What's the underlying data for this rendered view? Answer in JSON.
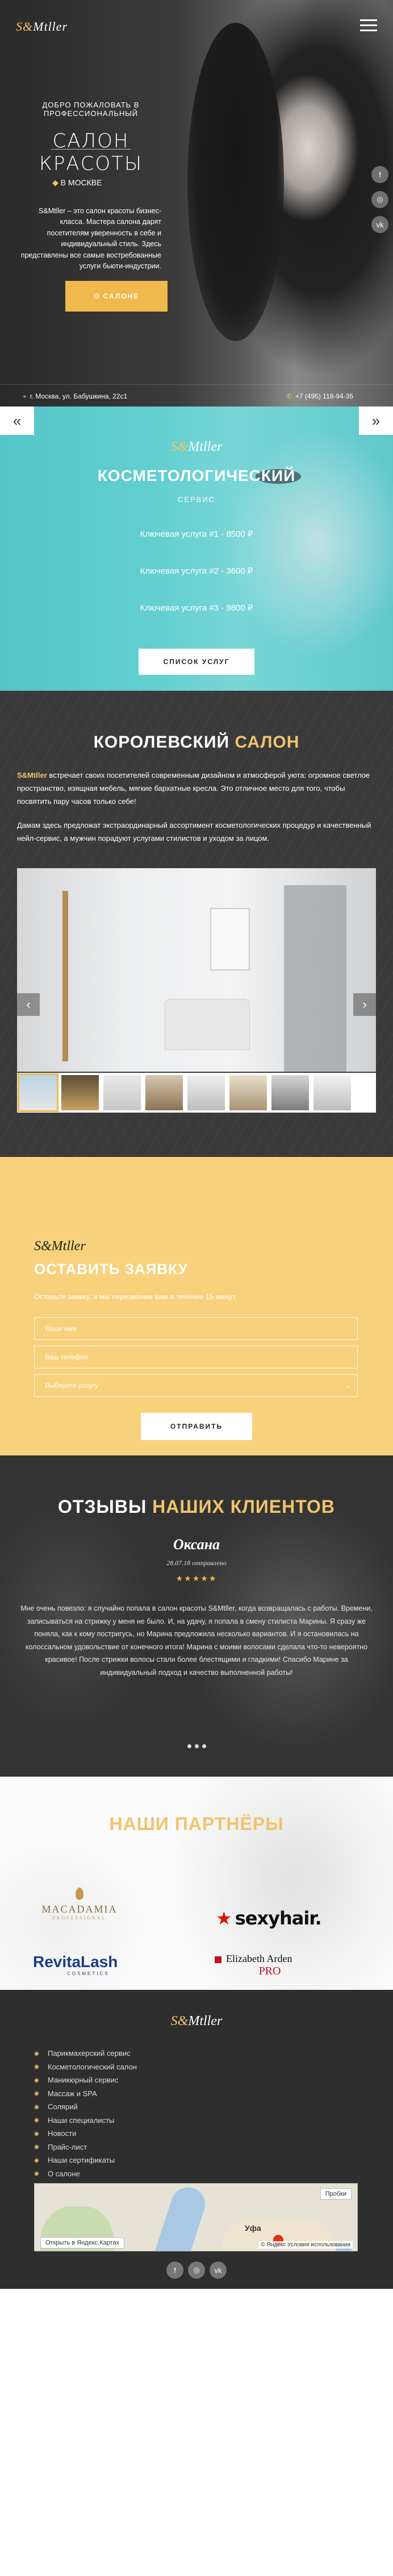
{
  "brand": {
    "logo_prefix": "S&",
    "logo_rest": "Mtller"
  },
  "hero": {
    "welcome": "ДОБРО ПОЖАЛОВАТЬ В ПРОФЕССИОНАЛЬНЫЙ",
    "title": "САЛОН КРАСОТЫ",
    "city_prefix": "В",
    "city": "МОСКВЕ",
    "intro": "S&Mtller – это салон красоты бизнес-класса. Мастера салона дарят посетителям уверенность в себе и индивидуальный стиль. Здесь представлены все самые востребованные услуги бьюти-индустрии.",
    "cta": "О САЛОНЕ",
    "address": "г. Москва, ул. Бабушкина, 22с1",
    "phone": "+7 (495) 118-94-35",
    "social": [
      "f",
      "◎",
      "vk"
    ]
  },
  "cosmetic": {
    "title": "КОСМЕТОЛОГИЧЕСКИЙ",
    "subtitle": "СЕРВИС",
    "services": [
      {
        "label": "Ключевая услуга #1 - 8500 ₽"
      },
      {
        "label": "Ключевая услуга #2 - 3600 ₽"
      },
      {
        "label": "Ключевая услуга #3 - 9800 ₽"
      }
    ],
    "cta": "СПИСОК УСЛУГ",
    "prev": "«",
    "next": "»"
  },
  "royal": {
    "title_a": "КОРОЛЕВСКИЙ",
    "title_b": "САЛОН",
    "p1_brand": "S&Mtller",
    "p1": " встречает своих посетителей современным дизайном и атмосферой уюта: огромное светлое пространство, изящная мебель, мягкие бархатные кресла. Это отличное место для того, чтобы посвятить пару часов только себе!",
    "p2": "Дамам здесь предложат экстраординарный ассортимент косметологических процедур и качественный нейл-сервис, а мужчин порадуют услугами стилистов и уходом за лицом.",
    "gallery_prev": "‹",
    "gallery_next": "›"
  },
  "form": {
    "title": "ОСТАВИТЬ ЗАЯВКУ",
    "note": "Оставьте заявку, и мы перезвоним вам в течение 15 минут.",
    "name_placeholder": "Ваше имя",
    "phone_placeholder": "Ваш телефон",
    "select_value": "Выберите услугу",
    "submit": "ОТПРАВИТЬ"
  },
  "reviews": {
    "title_a": "ОТЗЫВЫ",
    "title_b": "НАШИХ КЛИЕНТОВ",
    "name": "Оксана",
    "date": "28.07.18 отправлено",
    "stars": "★★★★★",
    "text": "Мне очень повезло: я случайно попала в салон красоты S&Mtller, когда возвращалась с работы. Времени, записываться на стрижку у меня не было. И, на удачу, я попала в смену стилиста Марины. Я сразу же поняла, как к кому постригусь, но Марина предложила несколько вариантов. И я остановилась на колоссальном удовольствие от конечного итога! Марина с моими волосами сделала что-то невероятно красивое! После стрижки волосы стали более блестящими и гладкими! Спасибо Марине за индивидуальный подход и качество выполненной работы!"
  },
  "partners": {
    "title": "НАШИ ПАРТНЁРЫ",
    "logos": {
      "macadamia": "MACADAMIA",
      "macadamia_sub": "PROFESSIONAL",
      "sexyhair": "sexyhair.",
      "revitalash": "RevitaLash",
      "revitalash_sub": "COSMETICS",
      "elizabeth": "Elizabeth Arden",
      "elizabeth_pro": "PRO"
    }
  },
  "footer": {
    "menu": [
      "Парикмахерский сервис",
      "Косметологический салон",
      "Маникюрный сервис",
      "Массаж и SPA",
      "Солярий",
      "Наши специалисты",
      "Новости",
      "Прайс-лист",
      "Наши сертификаты",
      "О салоне"
    ],
    "map": {
      "city": "Уфа",
      "route": "Пробки",
      "open": "Открыть в Яндекс.Картах",
      "copyright": "© Яндекс Условия использования"
    },
    "social": [
      "f",
      "◎",
      "vk"
    ]
  },
  "colors": {
    "gold": "#f0c46c",
    "teal": "#5ec8cb",
    "yellow": "#f8d17c"
  }
}
